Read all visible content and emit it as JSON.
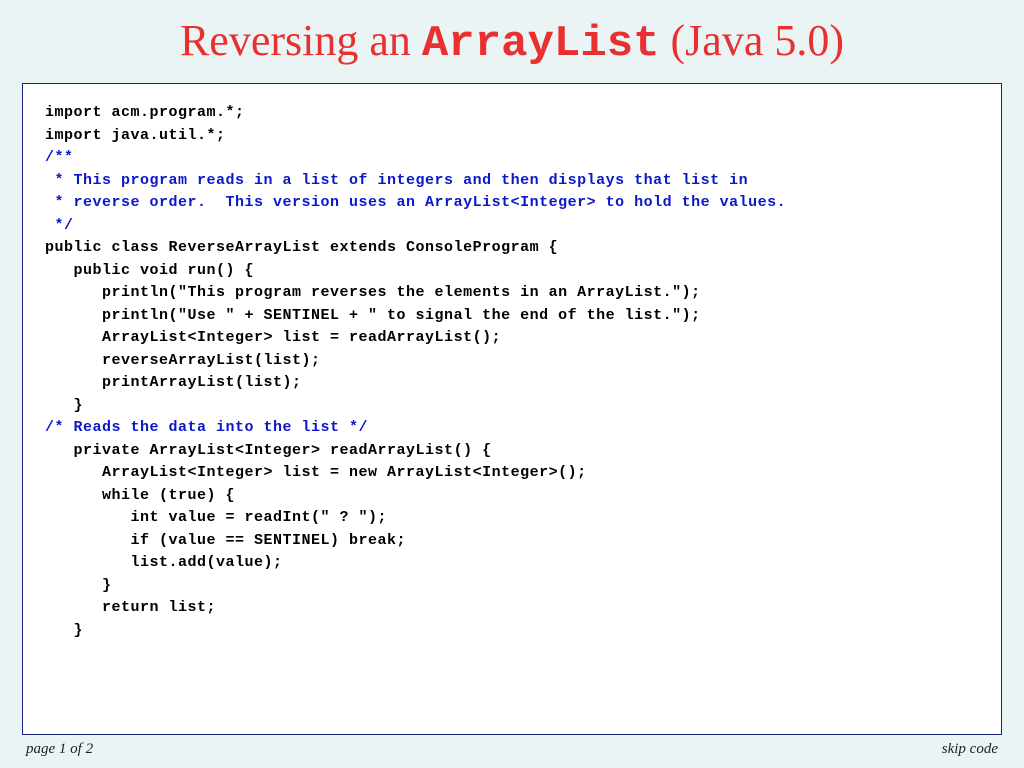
{
  "title_pre": "Reversing an ",
  "title_mono": "ArrayList",
  "title_post": " (Java 5.0)",
  "code": {
    "l1": "import acm.program.*;",
    "l2": "import java.util.*;",
    "l3": "",
    "l4": "/**",
    "l5": " * This program reads in a list of integers and then displays that list in",
    "l6": " * reverse order.  This version uses an ArrayList<Integer> to hold the values.",
    "l7": " */",
    "l8": "public class ReverseArrayList extends ConsoleProgram {",
    "l9": "",
    "l10": "   public void run() {",
    "l11": "      println(\"This program reverses the elements in an ArrayList.\");",
    "l12": "      println(\"Use \" + SENTINEL + \" to signal the end of the list.\");",
    "l13": "      ArrayList<Integer> list = readArrayList();",
    "l14": "      reverseArrayList(list);",
    "l15": "      printArrayList(list);",
    "l16": "   }",
    "l17": "",
    "l18": "/* Reads the data into the list */",
    "l19": "   private ArrayList<Integer> readArrayList() {",
    "l20": "      ArrayList<Integer> list = new ArrayList<Integer>();",
    "l21": "      while (true) {",
    "l22": "         int value = readInt(\" ? \");",
    "l23": "         if (value == SENTINEL) break;",
    "l24": "         list.add(value);",
    "l25": "      }",
    "l26": "      return list;",
    "l27": "   }"
  },
  "footer_left": "page 1 of 2",
  "footer_right": "skip code"
}
